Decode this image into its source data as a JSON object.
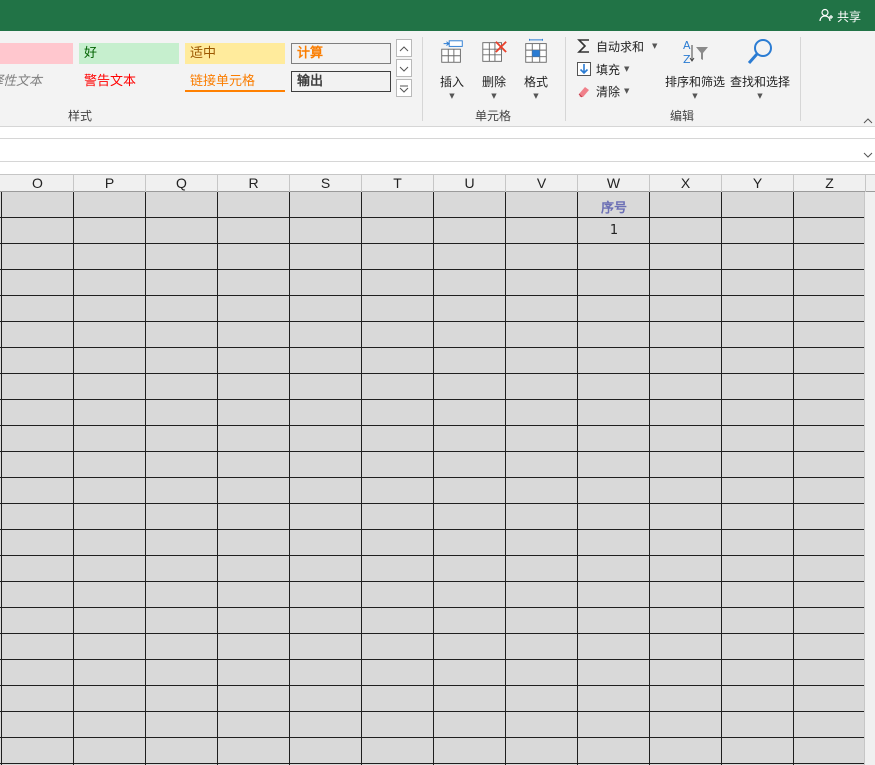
{
  "titlebar": {
    "share_label": "共享"
  },
  "ribbon": {
    "styles": {
      "bad": "",
      "good": "好",
      "neutral": "适中",
      "calculation": "计算",
      "explanatory": "解释性文本",
      "warning": "警告文本",
      "linked_cell": "链接单元格",
      "output": "输出",
      "group_label": "样式"
    },
    "cells": {
      "insert": "插入",
      "delete": "删除",
      "format": "格式",
      "group_label": "单元格"
    },
    "editing": {
      "autosum": "自动求和",
      "fill": "填充",
      "clear": "清除",
      "sort_filter": "排序和筛选",
      "find_select": "查找和选择",
      "group_label": "编辑"
    }
  },
  "grid": {
    "columns": [
      "O",
      "P",
      "Q",
      "R",
      "S",
      "T",
      "U",
      "V",
      "W",
      "X",
      "Y",
      "Z"
    ],
    "cells": {
      "W1": "序号",
      "W2": "1"
    },
    "header_color": "#6b6fb5",
    "fill_color": "#d9d9d9"
  },
  "colors": {
    "brand": "#217346"
  }
}
